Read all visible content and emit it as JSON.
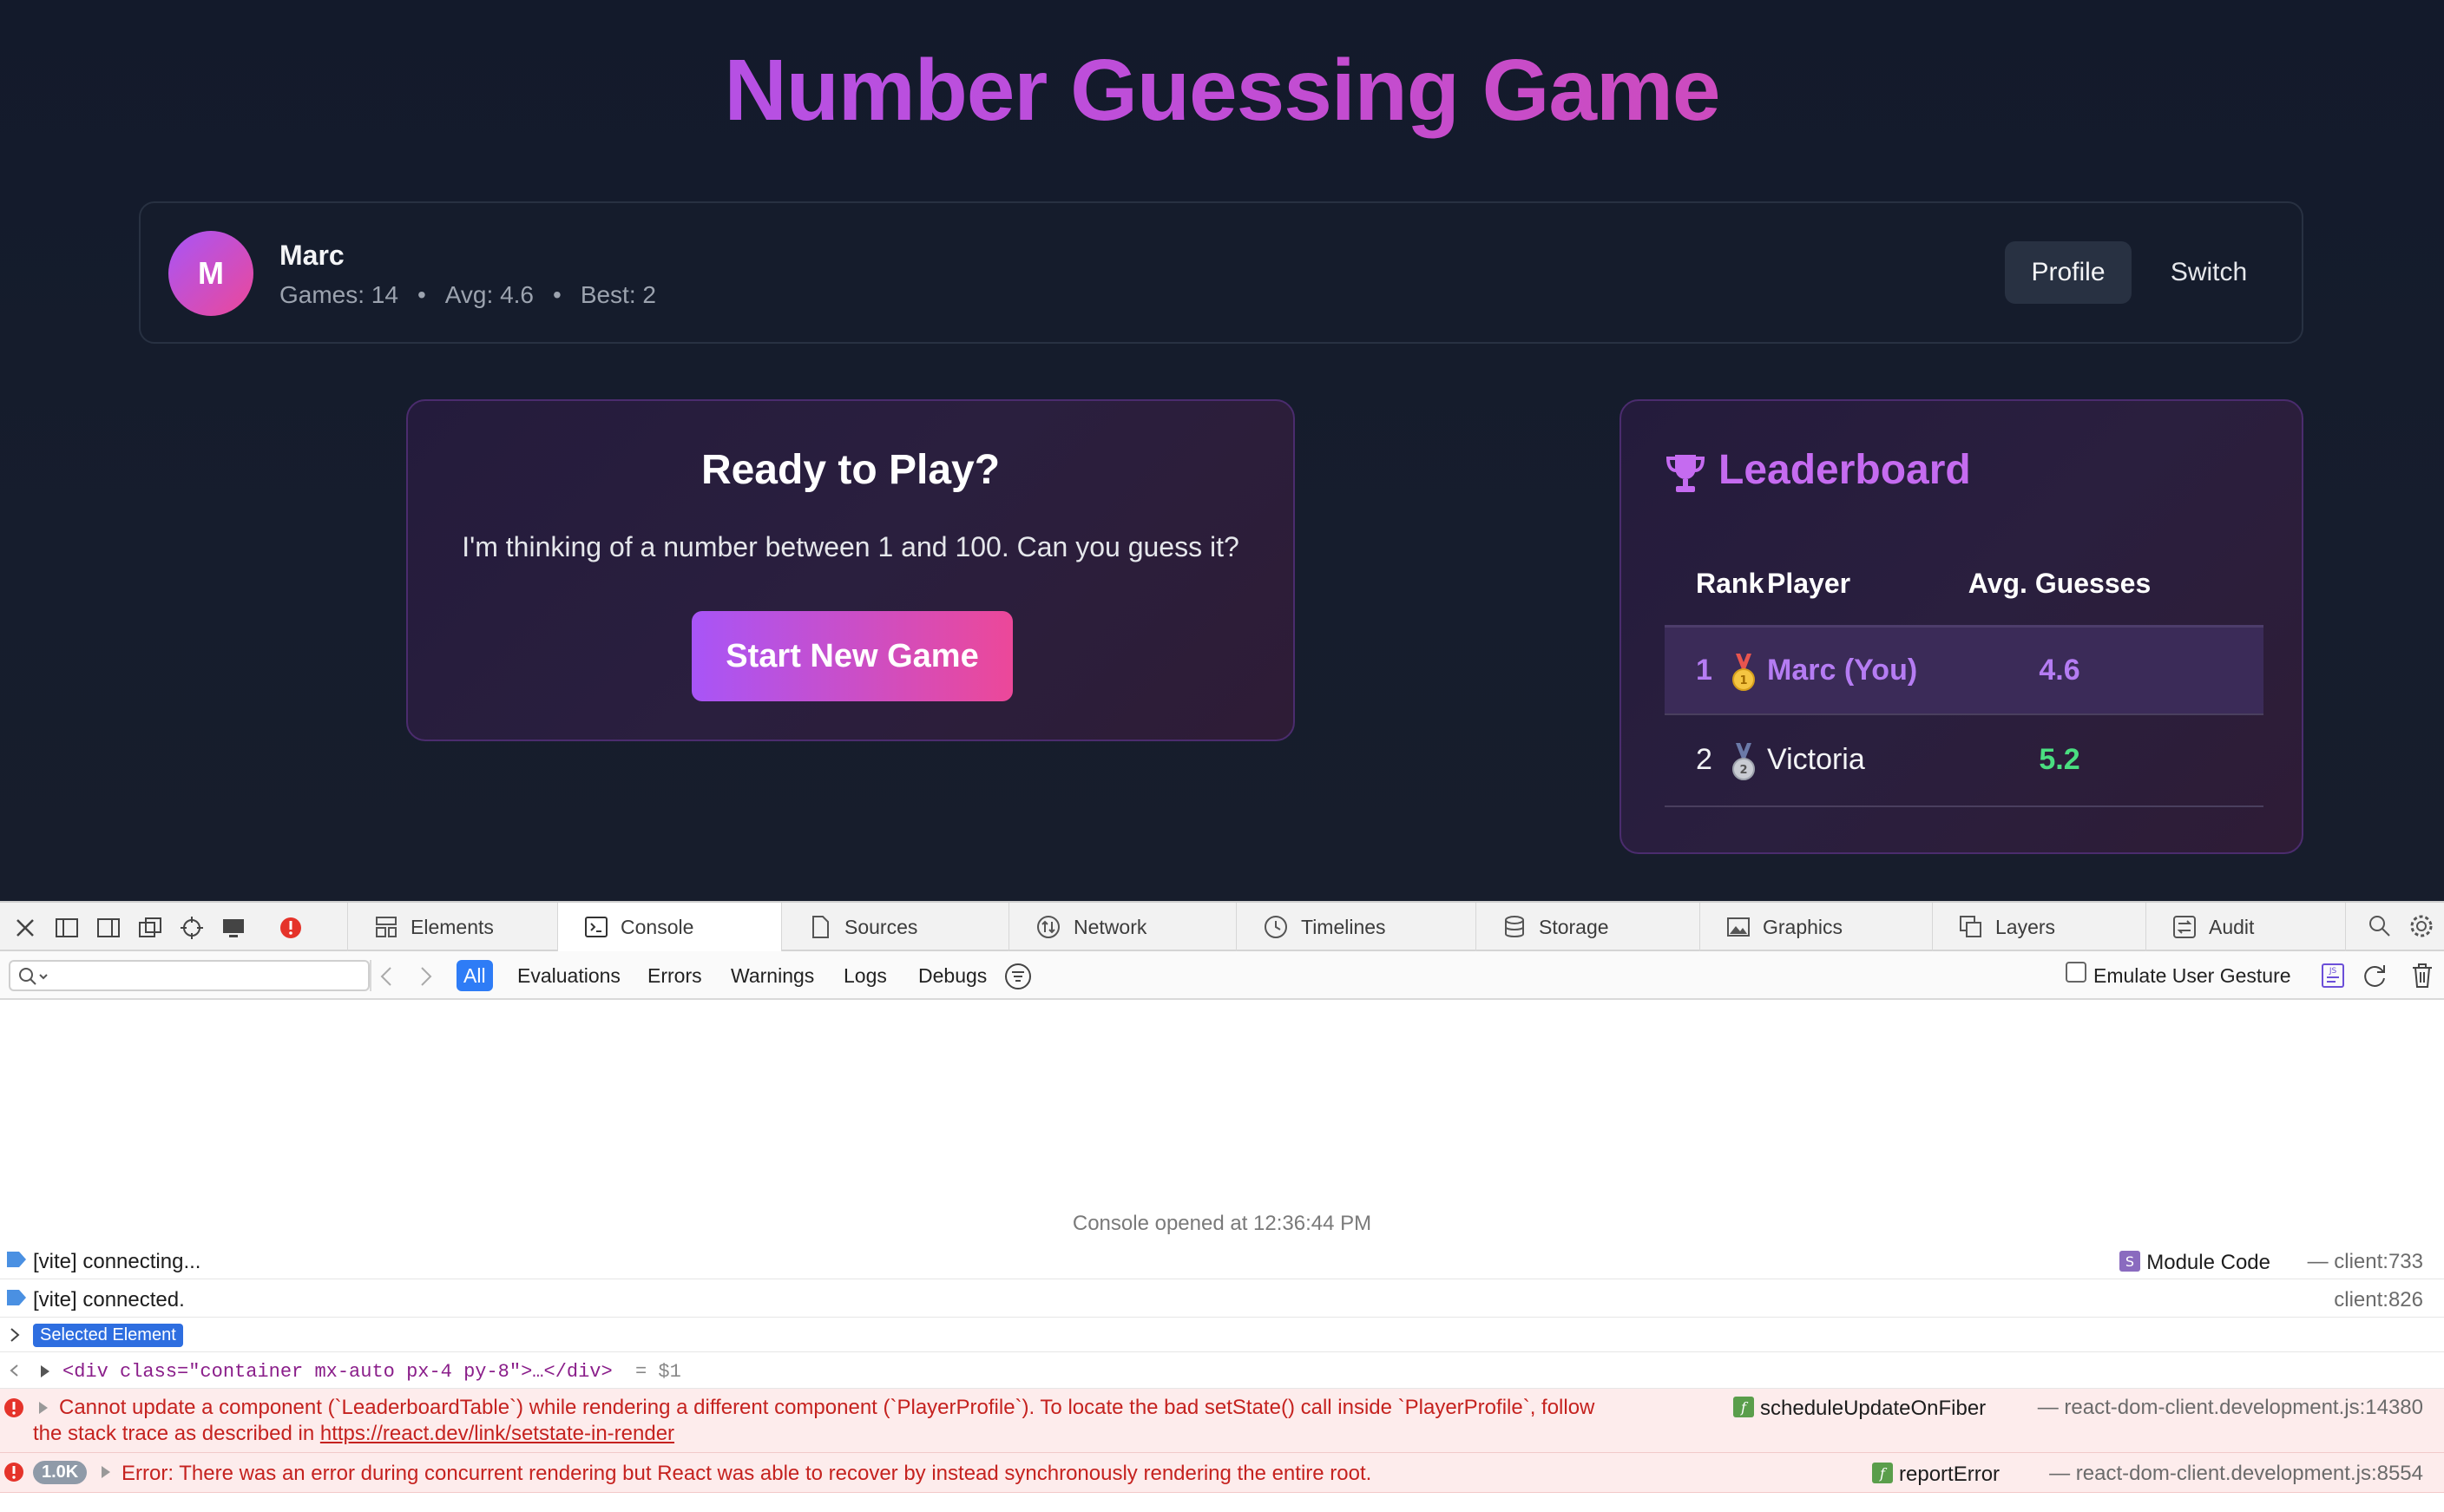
{
  "app": {
    "title": "Number Guessing Game",
    "player": {
      "initial": "M",
      "name": "Marc",
      "games": "Games: 14",
      "avg": "Avg: 4.6",
      "best": "Best: 2",
      "separator": "•"
    },
    "buttons": {
      "profile": "Profile",
      "switch": "Switch"
    },
    "play": {
      "title": "Ready to Play?",
      "description": "I'm thinking of a number between 1 and 100. Can you guess it?",
      "start": "Start New Game"
    },
    "leaderboard": {
      "title": "Leaderboard",
      "columns": [
        "Rank",
        "Player",
        "Avg. Guesses"
      ],
      "rows": [
        {
          "rank": "1",
          "player": "Marc (You)",
          "avg": "4.6",
          "medal": "gold-medal",
          "color": "#b57cf3",
          "avg_color": "#b57cf3"
        },
        {
          "rank": "2",
          "player": "Victoria",
          "avg": "5.2",
          "medal": "silver-medal",
          "color": "#f3f4f6",
          "avg_color": "#4ade80"
        }
      ]
    },
    "colors": {
      "accent_purple": "#a855f7",
      "accent_pink": "#ec4899",
      "background": "#151c2c"
    }
  },
  "devtools": {
    "tabs": [
      "Elements",
      "Console",
      "Sources",
      "Network",
      "Timelines",
      "Storage",
      "Graphics",
      "Layers",
      "Audit"
    ],
    "active_tab": "Console",
    "filters": [
      "All",
      "Evaluations",
      "Errors",
      "Warnings",
      "Logs",
      "Debugs"
    ],
    "emulate_label": "Emulate User Gesture",
    "console": {
      "opened": "Console opened at 12:36:44 PM",
      "lines": {
        "vite_connecting": "[vite] connecting...",
        "vite_connecting_source_label": "Module Code",
        "vite_connecting_source": "— client:733",
        "vite_connected": "[vite] connected.",
        "vite_connected_source": "client:826",
        "selected_element": "Selected Element",
        "element_code": "<div class=\"container mx-auto px-4 py-8\">…</div>",
        "element_ref": "= $1",
        "error1_line1": "Cannot update a component (`LeaderboardTable`) while rendering a different component (`PlayerProfile`). To locate the bad setState() call inside `PlayerProfile`, follow",
        "error1_line2_prefix": "the stack trace as described in ",
        "error1_link": "https://react.dev/link/setstate-in-render",
        "error1_fn": "scheduleUpdateOnFiber",
        "error1_source": "— react-dom-client.development.js:14380",
        "error2_count": "1.0K",
        "error2_text": "Error: There was an error during concurrent rendering but React was able to recover by instead synchronously rendering the entire root.",
        "error2_fn": "reportError",
        "error2_source": "— react-dom-client.development.js:8554"
      }
    }
  }
}
